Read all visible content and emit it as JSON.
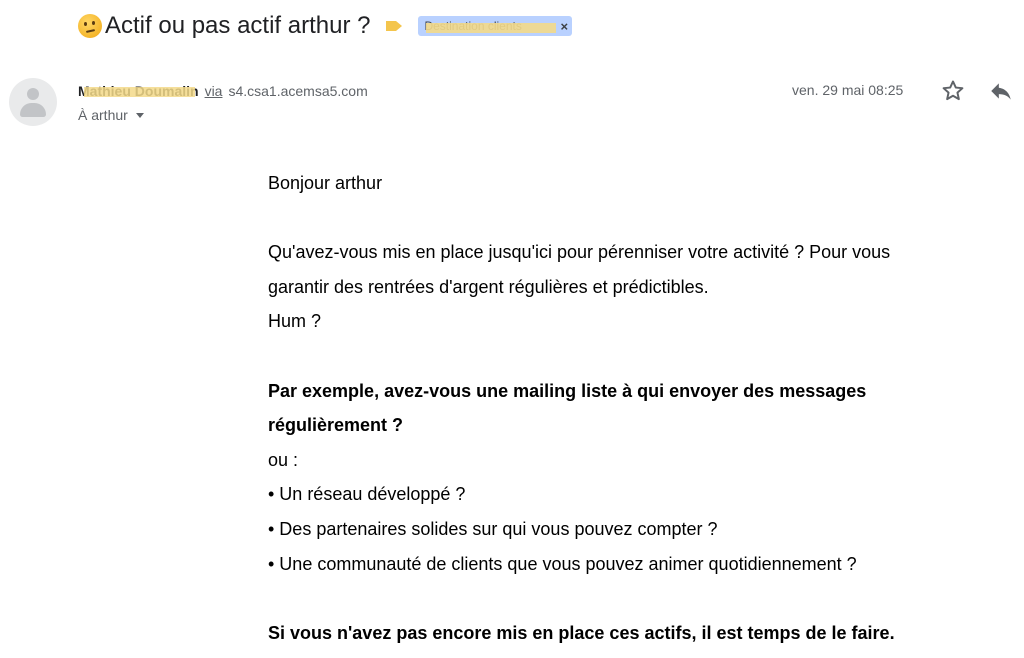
{
  "subject": {
    "emoji": "thinking-face-emoji",
    "text": "Actif ou pas actif arthur ?",
    "label": "Destination clients",
    "label_remove": "×"
  },
  "sender": {
    "name": "Mathieu Doumalin",
    "via": "via",
    "domain": "s4.csa1.acemsa5.com",
    "date": "ven. 29 mai 08:25"
  },
  "recipient": {
    "text": "À arthur"
  },
  "body": {
    "greeting": "Bonjour arthur",
    "p1_line1": "Qu'avez-vous mis en place jusqu'ici pour pérenniser votre activité ? Pour vous",
    "p1_line2": "garantir des rentrées d'argent régulières et prédictibles.",
    "p1_line3": "Hum ?",
    "bold1_line1": "Par exemple, avez-vous une mailing liste à qui envoyer des messages",
    "bold1_line2": "régulièrement ?",
    "or": "ou :",
    "bullets": [
      "• Un réseau développé ?",
      "• Des partenaires solides sur qui vous pouvez compter ?",
      "• Une communauté de clients que vous pouvez animer quotidiennement ?"
    ],
    "bold2": "Si vous n'avez pas encore mis en place ces actifs, il est temps de le faire."
  },
  "colors": {
    "label_bg": "#b9d1ff",
    "importance": "#f4c54d",
    "muted_text": "#5f6368"
  }
}
